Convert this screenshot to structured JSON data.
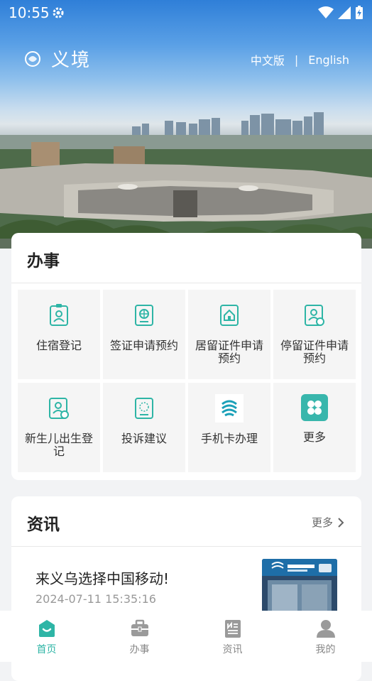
{
  "status_bar": {
    "time": "10:55",
    "icons": [
      "gear-icon",
      "wifi-icon",
      "signal-icon",
      "battery-charging-icon"
    ]
  },
  "header": {
    "app_title": "义境",
    "lang_zh": "中文版",
    "lang_separator": "|",
    "lang_en": "English"
  },
  "services": {
    "title": "办事",
    "items": [
      {
        "label": "住宿登记",
        "icon": "id-card-person-icon"
      },
      {
        "label": "签证申请预约",
        "icon": "passport-globe-icon"
      },
      {
        "label": "居留证件申请预约",
        "icon": "residence-house-icon"
      },
      {
        "label": "停留证件申请预约",
        "icon": "stay-permit-icon"
      },
      {
        "label": "新生儿出生登记",
        "icon": "newborn-registration-icon"
      },
      {
        "label": "投诉建议",
        "icon": "complaint-suggestion-icon"
      },
      {
        "label": "手机卡办理",
        "icon": "china-mobile-icon"
      },
      {
        "label": "更多",
        "icon": "more-grid-icon"
      }
    ]
  },
  "news": {
    "title": "资讯",
    "more": "更多",
    "items": [
      {
        "title": "来义乌选择中国移动!",
        "time": "2024-07-11 15:35:16",
        "thumb": "china-mobile-store-photo"
      }
    ]
  },
  "tabs": [
    {
      "label": "首页",
      "icon": "home-smile-icon",
      "active": true
    },
    {
      "label": "办事",
      "icon": "briefcase-icon",
      "active": false
    },
    {
      "label": "资讯",
      "icon": "newspaper-icon",
      "active": false
    },
    {
      "label": "我的",
      "icon": "user-icon",
      "active": false
    }
  ],
  "colors": {
    "accent": "#2eb5a6",
    "hero_sky": "#2f7fd8"
  }
}
